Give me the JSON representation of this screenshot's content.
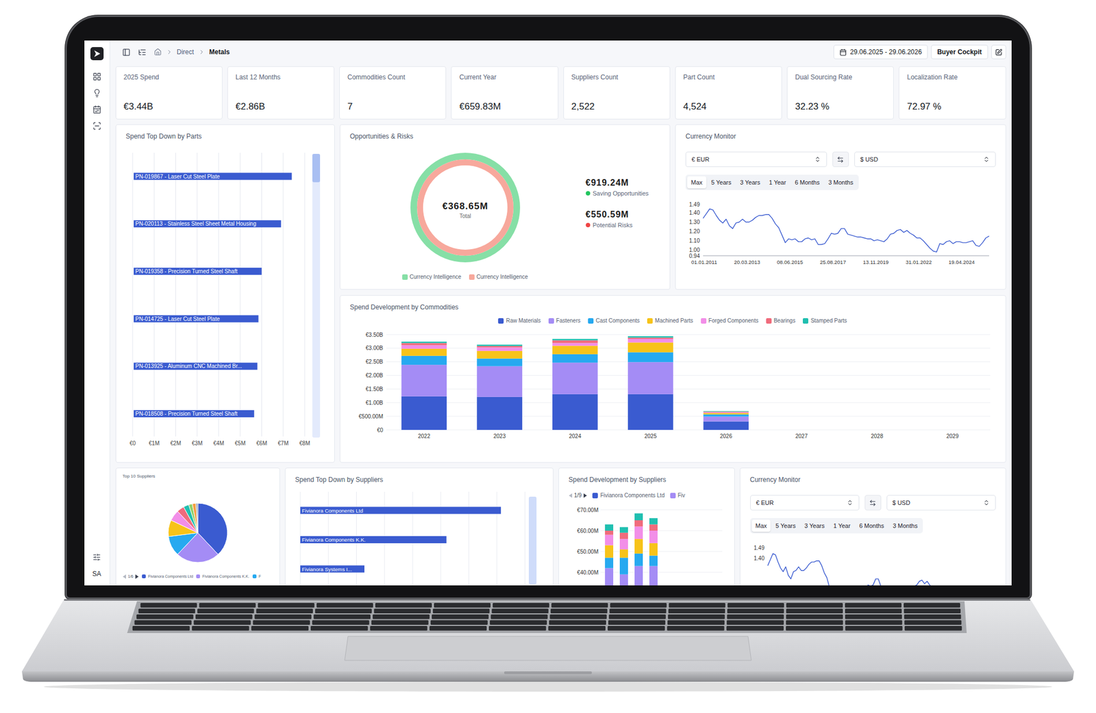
{
  "breadcrumb": [
    {
      "label": "Direct",
      "selected": false
    },
    {
      "label": "Metals",
      "selected": true
    }
  ],
  "date_range": "29.06.2025 - 29.06.2026",
  "view_button": "Buyer Cockpit",
  "user": "SA",
  "kpis": [
    {
      "label": "2025 Spend",
      "value": "€3.44B"
    },
    {
      "label": "Last 12 Months",
      "value": "€2.86B"
    },
    {
      "label": "Commodities Count",
      "value": "7"
    },
    {
      "label": "Current Year",
      "value": "€659.83M"
    },
    {
      "label": "Suppliers Count",
      "value": "2,522"
    },
    {
      "label": "Part Count",
      "value": "4,524"
    },
    {
      "label": "Dual Sourcing Rate",
      "value": "32.23 %"
    },
    {
      "label": "Localization Rate",
      "value": "72.97 %"
    }
  ],
  "parts_chart": {
    "title": "Spend Top Down by Parts",
    "x_ticks": [
      "€0",
      "€1M",
      "€2M",
      "€3M",
      "€4M",
      "€5M",
      "€6M",
      "€7M",
      "€8M"
    ],
    "bars": [
      {
        "label": "PN-019867 - Laser Cut Steel Plate",
        "value": 7.4
      },
      {
        "label": "PN-020113 - Stainless Steel Sheet Metal Housing",
        "value": 6.9
      },
      {
        "label": "PN-019358 - Precision Turned Steel Shaft",
        "value": 6.0
      },
      {
        "label": "PN-014725 - Laser Cut Steel Plate",
        "value": 5.85
      },
      {
        "label": "PN-013925 - Aluminum CNC Machined Br...",
        "value": 5.8
      },
      {
        "label": "PN-018508 - Precision Turned Steel Shaft",
        "value": 5.65
      }
    ],
    "scroll": {
      "level": 0.1
    }
  },
  "opportunities": {
    "title": "Opportunities & Risks",
    "total": "€368.65M",
    "total_label": "Total",
    "items": [
      {
        "value": "€919.24M",
        "label": "Saving Opportunities",
        "color": "#22c55e"
      },
      {
        "value": "€550.59M",
        "label": "Potential Risks",
        "color": "#ef4444"
      }
    ],
    "legend": [
      {
        "label": "Currency Intelligence",
        "color": "#86dfa6"
      },
      {
        "label": "Currency Intelligence",
        "color": "#f7a89c"
      }
    ]
  },
  "currency_monitor": {
    "title": "Currency Monitor",
    "from": "€ EUR",
    "to": "$ USD",
    "ranges": [
      {
        "label": "Max",
        "selected": true
      },
      {
        "label": "5 Years",
        "selected": false
      },
      {
        "label": "3 Years",
        "selected": false
      },
      {
        "label": "1 Year",
        "selected": false
      },
      {
        "label": "6 Months",
        "selected": false
      },
      {
        "label": "3 Months",
        "selected": false
      }
    ],
    "y_ticks": [
      "1.49",
      "1.40",
      "1.30",
      "1.20",
      "1.10",
      "1.00",
      "0.94"
    ],
    "x_ticks": [
      "01.01.2011",
      "20.03.2013",
      "08.06.2015",
      "25.08.2017",
      "13.11.2019",
      "31.01.2022",
      "19.04.2024"
    ],
    "series": [
      1.34,
      1.39,
      1.44,
      1.43,
      1.37,
      1.32,
      1.29,
      1.33,
      1.26,
      1.23,
      1.29,
      1.3,
      1.33,
      1.3,
      1.3,
      1.32,
      1.35,
      1.37,
      1.37,
      1.38,
      1.38,
      1.34,
      1.28,
      1.24,
      1.16,
      1.08,
      1.12,
      1.11,
      1.12,
      1.09,
      1.09,
      1.12,
      1.13,
      1.11,
      1.12,
      1.06,
      1.06,
      1.07,
      1.12,
      1.18,
      1.17,
      1.18,
      1.23,
      1.23,
      1.17,
      1.16,
      1.15,
      1.14,
      1.14,
      1.13,
      1.12,
      1.12,
      1.1,
      1.11,
      1.1,
      1.09,
      1.12,
      1.17,
      1.18,
      1.21,
      1.22,
      1.19,
      1.21,
      1.18,
      1.16,
      1.13,
      1.13,
      1.1,
      1.06,
      1.02,
      0.99,
      0.98,
      1.07,
      1.06,
      1.09,
      1.1,
      1.07,
      1.09,
      1.09,
      1.08,
      1.08,
      1.09,
      1.1,
      1.05,
      1.04,
      1.08,
      1.13,
      1.15
    ]
  },
  "commodities_chart": {
    "title": "Spend Development by Commodities",
    "y_ticks": [
      "€3.50B",
      "€3.00B",
      "€2.50B",
      "€2.00B",
      "€1.50B",
      "€1.00B",
      "€500.00M",
      "€0"
    ],
    "years": [
      "2022",
      "2023",
      "2024",
      "2025",
      "2026",
      "2027",
      "2028",
      "2029"
    ],
    "series": [
      {
        "name": "Raw Materials",
        "color": "#3a5bd0",
        "values": [
          1230,
          1210,
          1310,
          1310,
          310,
          0,
          0,
          0
        ]
      },
      {
        "name": "Fasteners",
        "color": "#a48cf5",
        "values": [
          1160,
          1130,
          1160,
          1180,
          180,
          0,
          0,
          0
        ]
      },
      {
        "name": "Cast Components",
        "color": "#26a9f0",
        "values": [
          330,
          280,
          310,
          360,
          80,
          0,
          0,
          0
        ]
      },
      {
        "name": "Machined Parts",
        "color": "#f7c319",
        "values": [
          260,
          280,
          310,
          360,
          50,
          0,
          0,
          0
        ]
      },
      {
        "name": "Forged Components",
        "color": "#f28ee8",
        "values": [
          130,
          130,
          100,
          130,
          30,
          0,
          0,
          0
        ]
      },
      {
        "name": "Bearings",
        "color": "#f06b7c",
        "values": [
          80,
          50,
          100,
          50,
          20,
          0,
          0,
          0
        ]
      },
      {
        "name": "Stamped Parts",
        "color": "#20bfb0",
        "values": [
          50,
          50,
          50,
          50,
          20,
          0,
          0,
          0
        ]
      }
    ]
  },
  "top_suppliers": {
    "title": "Top 10 Suppliers",
    "pager": "1/6",
    "slices": [
      {
        "value": 38,
        "color": "#3a5bd0"
      },
      {
        "value": 24,
        "color": "#a48cf5"
      },
      {
        "value": 11,
        "color": "#26a9f0"
      },
      {
        "value": 9,
        "color": "#f7c319"
      },
      {
        "value": 6,
        "color": "#f28ee8"
      },
      {
        "value": 4,
        "color": "#f06b7c"
      },
      {
        "value": 3,
        "color": "#20bfb0"
      },
      {
        "value": 2,
        "color": "#8fd16b"
      },
      {
        "value": 2,
        "color": "#f59e42"
      },
      {
        "value": 1,
        "color": "#94a3b8"
      }
    ],
    "legend": [
      {
        "label": "Fivianora Components Ltd",
        "color": "#3a5bd0"
      },
      {
        "label": "Fivianora Components K.K.",
        "color": "#a48cf5"
      },
      {
        "label": "F",
        "color": "#26a9f0"
      }
    ]
  },
  "supplier_bars": {
    "title": "Spend Top Down by Suppliers",
    "bars": [
      {
        "label": "Fivianora Components Ltd",
        "value": 58.2
      },
      {
        "label": "Fivianora Components K.K.",
        "value": 42.4
      },
      {
        "label": "Fivianora Systems I...",
        "value": 18.6
      }
    ],
    "scroll": {
      "level": 1
    }
  },
  "supplier_development": {
    "title": "Spend Development by Suppliers",
    "pager": "1/9",
    "legend": [
      {
        "label": "Fivianora Components Ltd",
        "color": "#3a5bd0"
      },
      {
        "label": "Fiv",
        "color": "#a48cf5"
      }
    ],
    "y_ticks": [
      "€70.00M",
      "€60.00M",
      "€50.00M",
      "€40.00M"
    ],
    "series": [
      {
        "color": "#3a5bd0",
        "values": [
          28,
          27,
          30,
          29
        ]
      },
      {
        "color": "#a48cf5",
        "values": [
          14,
          12,
          13,
          14
        ]
      },
      {
        "color": "#26a9f0",
        "values": [
          5,
          8,
          6,
          5
        ]
      },
      {
        "color": "#f7c319",
        "values": [
          6,
          4,
          7,
          6
        ]
      },
      {
        "color": "#f28ee8",
        "values": [
          5,
          5,
          6,
          6
        ]
      },
      {
        "color": "#f06b7c",
        "values": [
          2,
          3,
          3,
          3
        ]
      },
      {
        "color": "#20bfb0",
        "values": [
          3,
          2.7,
          3.3,
          3
        ]
      }
    ]
  },
  "currency_monitor_2": {
    "title": "Currency Monitor",
    "from": "€ EUR",
    "to": "$ USD",
    "ranges": [
      {
        "label": "Max",
        "selected": true
      },
      {
        "label": "5 Years",
        "selected": false
      },
      {
        "label": "3 Years",
        "selected": false
      },
      {
        "label": "1 Year",
        "selected": false
      },
      {
        "label": "6 Months",
        "selected": false
      },
      {
        "label": "3 Months",
        "selected": false
      }
    ],
    "y_ticks": [
      "1.49",
      "1.40"
    ],
    "x_ticks": [],
    "series": [
      1.34,
      1.39,
      1.44,
      1.43,
      1.37,
      1.32,
      1.29,
      1.33,
      1.26,
      1.23,
      1.29,
      1.3,
      1.33,
      1.3,
      1.3,
      1.32,
      1.35,
      1.37,
      1.37,
      1.38,
      1.38,
      1.34,
      1.28,
      1.24,
      1.16,
      1.08,
      1.12,
      1.11,
      1.12,
      1.09,
      1.09,
      1.12,
      1.13,
      1.11,
      1.12,
      1.06,
      1.06,
      1.07,
      1.12,
      1.18,
      1.17,
      1.18,
      1.23,
      1.23,
      1.17,
      1.16,
      1.15,
      1.14,
      1.14,
      1.13,
      1.12,
      1.12,
      1.1,
      1.11,
      1.1,
      1.09,
      1.12,
      1.17,
      1.18,
      1.21,
      1.22,
      1.19,
      1.21,
      1.18,
      1.16,
      1.13,
      1.13,
      1.1,
      1.06,
      1.02,
      0.99,
      0.98,
      1.07,
      1.06,
      1.09,
      1.1,
      1.07,
      1.09,
      1.09,
      1.08,
      1.08,
      1.09,
      1.1,
      1.05,
      1.04,
      1.08,
      1.13,
      1.15
    ]
  }
}
